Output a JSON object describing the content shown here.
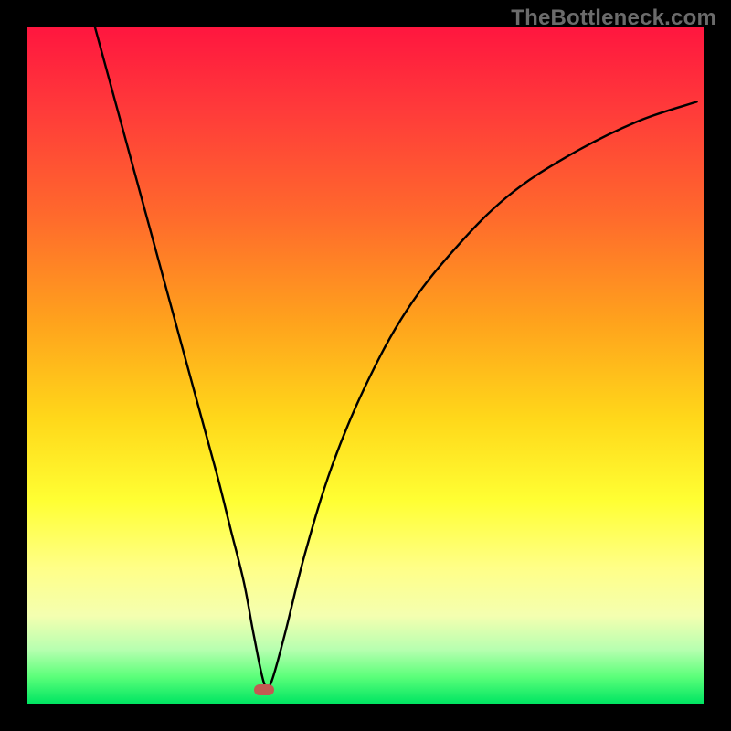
{
  "watermark": "TheBottleneck.com",
  "chart_data": {
    "type": "line",
    "title": "",
    "xlabel": "",
    "ylabel": "",
    "xlim": [
      0,
      100
    ],
    "ylim": [
      0,
      100
    ],
    "grid": false,
    "legend": false,
    "series": [
      {
        "name": "curve",
        "x": [
          10,
          13,
          16,
          19,
          22,
          25,
          28,
          30,
          32,
          33.5,
          35,
          36,
          38,
          41,
          45,
          50,
          56,
          63,
          71,
          80,
          90,
          99
        ],
        "values": [
          100,
          89,
          78,
          67,
          56,
          45,
          34,
          26,
          18,
          10,
          3,
          3,
          10,
          22,
          35,
          47,
          58,
          67,
          75,
          81,
          86,
          89
        ]
      }
    ],
    "marker": {
      "x": 35,
      "y": 2,
      "shape": "rounded-rect",
      "color": "#c25a52"
    },
    "background_gradient": {
      "direction": "vertical",
      "stops": [
        {
          "pos": 0.0,
          "color": "#ff163f"
        },
        {
          "pos": 0.28,
          "color": "#ff6a2c"
        },
        {
          "pos": 0.58,
          "color": "#ffd81a"
        },
        {
          "pos": 0.8,
          "color": "#ffff88"
        },
        {
          "pos": 0.92,
          "color": "#b7ffb0"
        },
        {
          "pos": 1.0,
          "color": "#00e562"
        }
      ]
    }
  }
}
